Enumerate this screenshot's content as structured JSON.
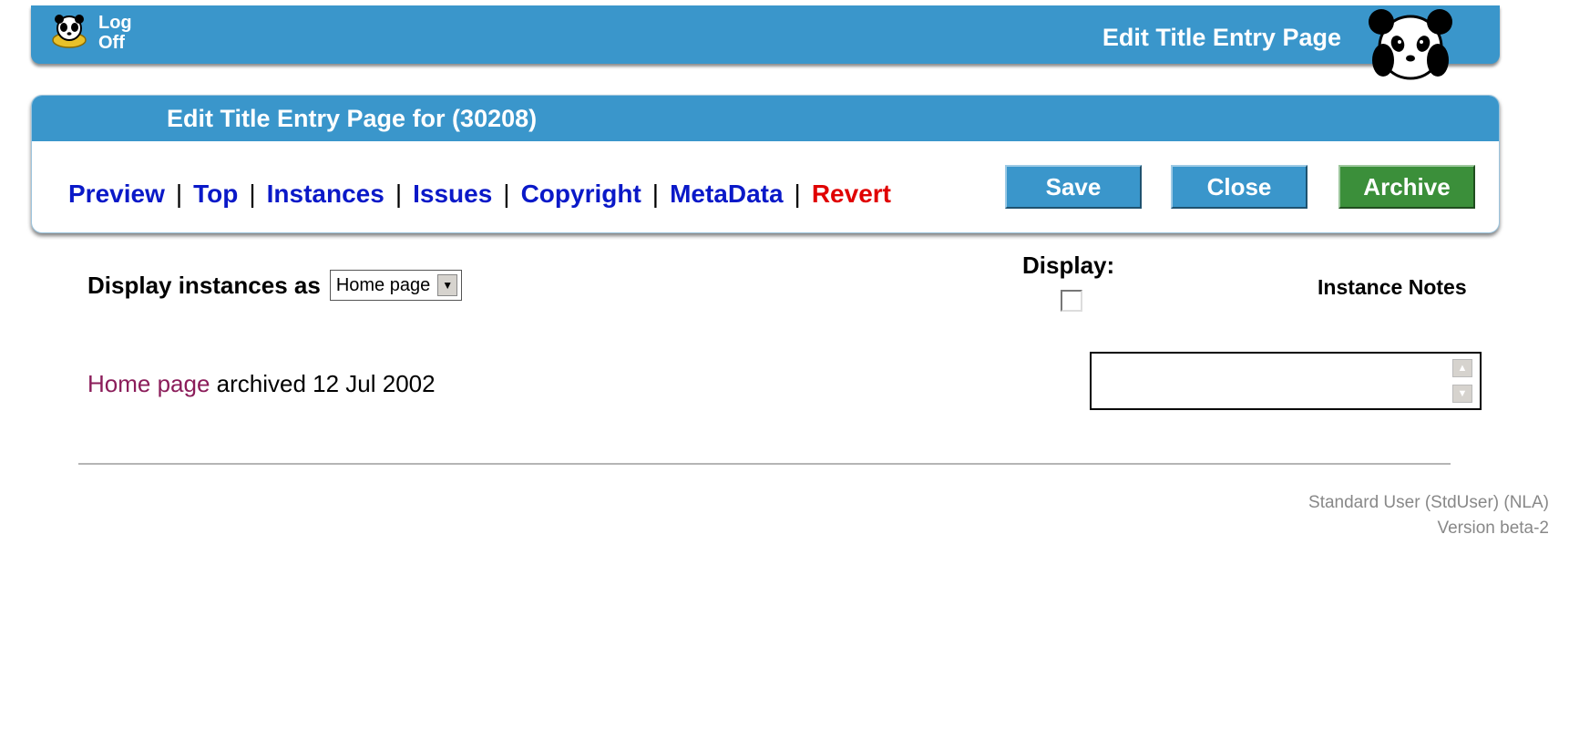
{
  "topbar": {
    "logoff_line1": "Log",
    "logoff_line2": "Off",
    "title": "Edit Title Entry Page"
  },
  "panel": {
    "heading": "Edit Title Entry Page for (30208)",
    "nav": [
      {
        "label": "Preview"
      },
      {
        "label": "Top"
      },
      {
        "label": "Instances"
      },
      {
        "label": "Issues"
      },
      {
        "label": "Copyright"
      },
      {
        "label": "MetaData"
      },
      {
        "label": "Revert"
      }
    ],
    "separator": "|",
    "buttons": {
      "save": "Save",
      "close": "Close",
      "archive": "Archive"
    }
  },
  "content": {
    "display_as_label": "Display instances as",
    "display_as_selected": "Home page",
    "display_label": "Display:",
    "display_checked": false,
    "notes_label": "Instance Notes",
    "instance": {
      "link": "Home page",
      "text": "archived 12 Jul 2002"
    },
    "notes_value": ""
  },
  "footer": {
    "user": "Standard User (StdUser) (NLA)",
    "version": "Version beta-2"
  },
  "colors": {
    "bar_blue": "#3a96cb",
    "link_blue": "#0a19c8",
    "revert_red": "#e00000",
    "archive_green": "#3b8f3a",
    "instance_link": "#8b1d5a"
  },
  "icons": {
    "logoff": "panda-key-icon",
    "logo": "panda-logo-icon",
    "select": "chevron-down-icon"
  }
}
